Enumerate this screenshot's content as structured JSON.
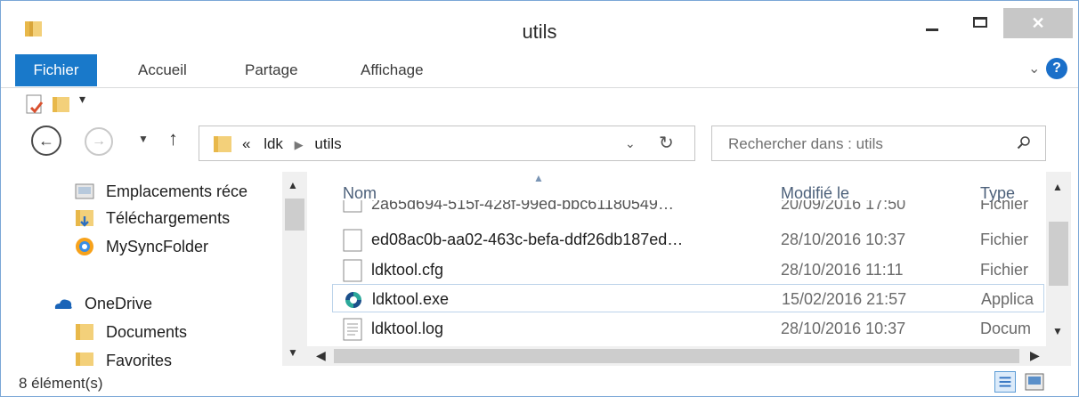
{
  "window": {
    "title": "utils"
  },
  "ribbon": {
    "tabs": [
      "Fichier",
      "Accueil",
      "Partage",
      "Affichage"
    ],
    "help": "?"
  },
  "address": {
    "prefix": "«",
    "crumbs": [
      "ldk",
      "utils"
    ]
  },
  "search": {
    "placeholder": "Rechercher dans : utils"
  },
  "sidebar": {
    "items": [
      {
        "label": "Emplacements réce",
        "icon": "recent-places-icon"
      },
      {
        "label": "Téléchargements",
        "icon": "downloads-folder-icon"
      },
      {
        "label": "MySyncFolder",
        "icon": "sync-folder-icon"
      },
      {
        "label": "OneDrive",
        "icon": "onedrive-cloud-icon"
      },
      {
        "label": "Documents",
        "icon": "folder-icon"
      },
      {
        "label": "Favorites",
        "icon": "folder-icon"
      }
    ]
  },
  "filelist": {
    "columns": {
      "name": "Nom",
      "modified": "Modifié le",
      "type": "Type"
    },
    "rows": [
      {
        "name": "2a65d694-515f-428f-99ed-bbc61180549…",
        "date": "20/09/2016 17:50",
        "type": "Fichier",
        "icon": "file-icon"
      },
      {
        "name": "ed08ac0b-aa02-463c-befa-ddf26db187ed…",
        "date": "28/10/2016 10:37",
        "type": "Fichier",
        "icon": "file-icon"
      },
      {
        "name": "ldktool.cfg",
        "date": "28/10/2016 11:11",
        "type": "Fichier",
        "icon": "file-icon"
      },
      {
        "name": "ldktool.exe",
        "date": "15/02/2016 21:57",
        "type": "Applica",
        "icon": "app-exe-icon"
      },
      {
        "name": "ldktool.log",
        "date": "28/10/2016 10:37",
        "type": "Docum",
        "icon": "text-document-icon"
      }
    ]
  },
  "status": {
    "count": "8 élément(s)"
  },
  "colors": {
    "accent": "#1979ca",
    "header_text": "#4c607a",
    "selection_border": "#bcd3ea"
  }
}
